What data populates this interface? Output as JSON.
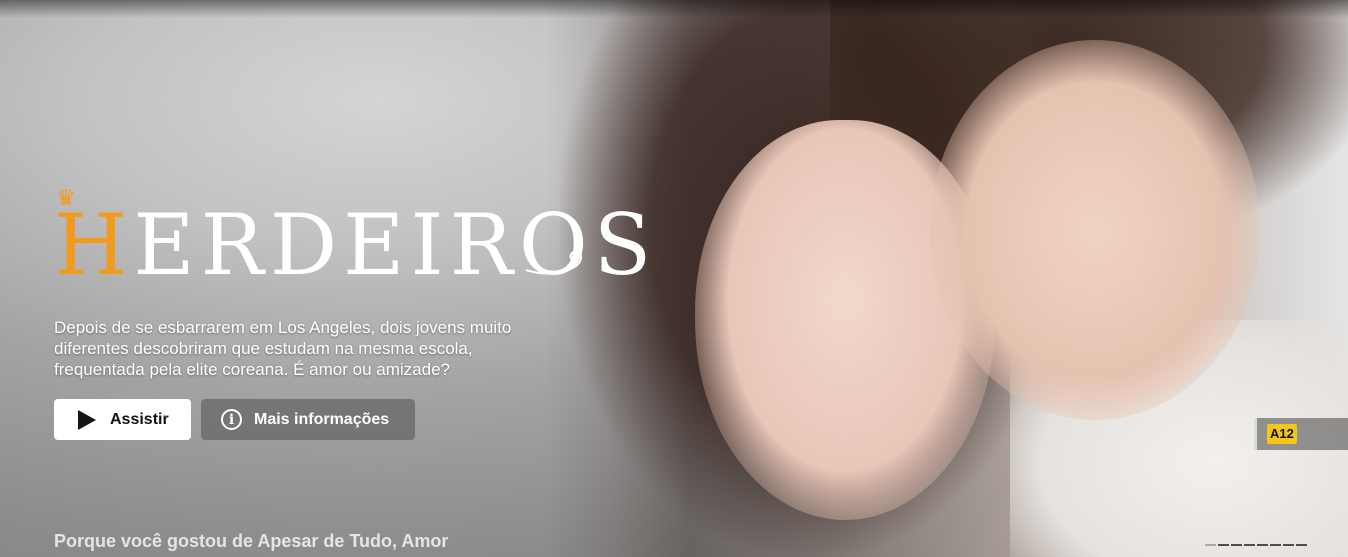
{
  "hero": {
    "title": "HERDEIROS",
    "title_first_letter": "H",
    "title_rest": "ERDEIROS",
    "synopsis": "Depois de se esbarrarem em Los Angeles, dois jovens muito diferentes descobriram que estudam na mesma escola, frequentada pela elite coreana. É amor ou amizade?",
    "play_label": "Assistir",
    "info_label": "Mais informações",
    "maturity_rating": "A12",
    "accent_color": "#f29a1d",
    "rating_color": "#f5c518"
  },
  "row": {
    "title": "Porque você gostou de Apesar de Tudo, Amor"
  },
  "icons": {
    "play": "play-icon",
    "info": "info-icon",
    "crown": "crown-icon"
  }
}
